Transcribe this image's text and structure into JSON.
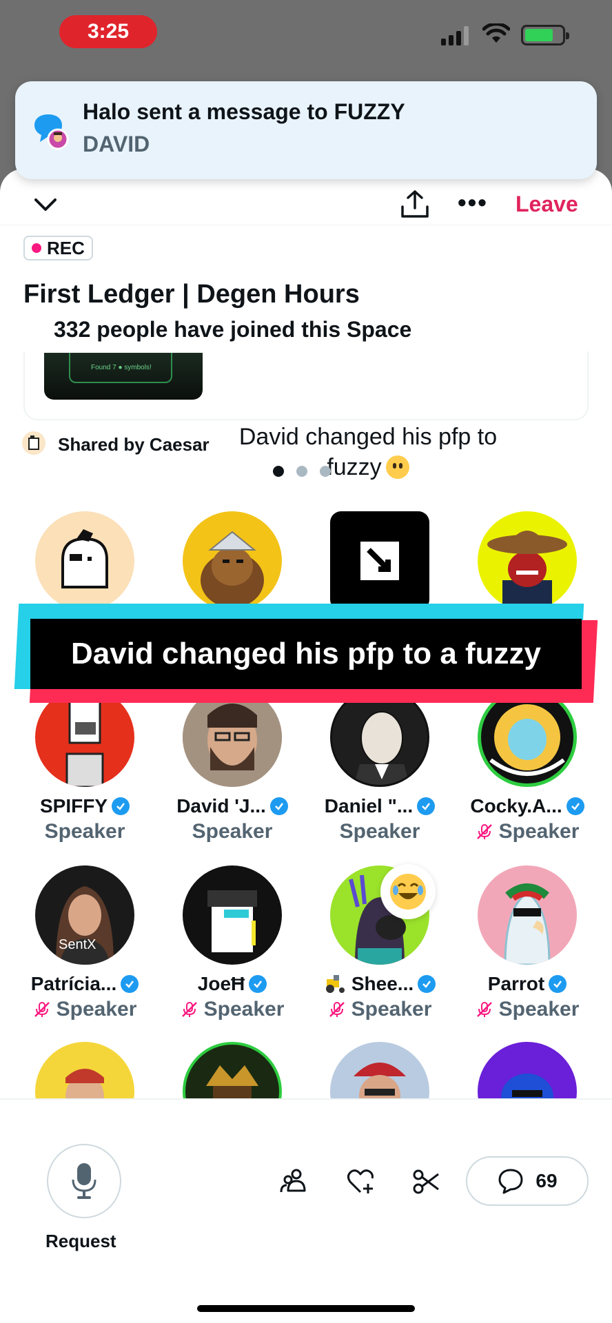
{
  "status_bar": {
    "time": "3:25"
  },
  "notification": {
    "line1": "Halo sent a message to FUZZY",
    "line2": "DAVID"
  },
  "header": {
    "leave": "Leave",
    "more": "•••"
  },
  "space": {
    "rec": "REC",
    "title": "First Ledger | Degen Hours",
    "joined": "332 people have joined this Space",
    "shared_image_caption": "Found 7 ● symbols!",
    "shared_by": "Shared by Caesar",
    "pfp_note": "David changed his pfp to fuzzy"
  },
  "caption_banner": "David changed his pfp to a fuzzy",
  "speakers": [
    {
      "name": "SPIFFY",
      "role": "Speaker"
    },
    {
      "name": "David 'J...",
      "role": "Speaker"
    },
    {
      "name": "Daniel \"...",
      "role": "Speaker"
    },
    {
      "name": "Cocky.A...",
      "role": "Speaker"
    },
    {
      "name": "Patrícia...",
      "role": "Speaker",
      "avatar_text": "SentX"
    },
    {
      "name": "JoeĦ",
      "role": "Speaker"
    },
    {
      "name": "Shee...",
      "role": "Speaker"
    },
    {
      "name": "Parrot",
      "role": "Speaker"
    }
  ],
  "bottom_bar": {
    "request": "Request",
    "comment_count": "69"
  },
  "colors": {
    "leave": "#e0245e",
    "verified": "#1d9bf0",
    "rec_dot": "#f91880",
    "banner_cyan": "#25d0e8",
    "banner_red": "#fe2c55"
  },
  "icons": [
    "chevron-down-icon",
    "share-icon",
    "more-icon",
    "message-icon",
    "verified-icon",
    "muted-mic-icon",
    "microphone-icon",
    "people-icon",
    "heart-plus-icon",
    "scissors-icon",
    "comment-icon",
    "laughing-emoji-icon",
    "tractor-emoji-icon"
  ]
}
